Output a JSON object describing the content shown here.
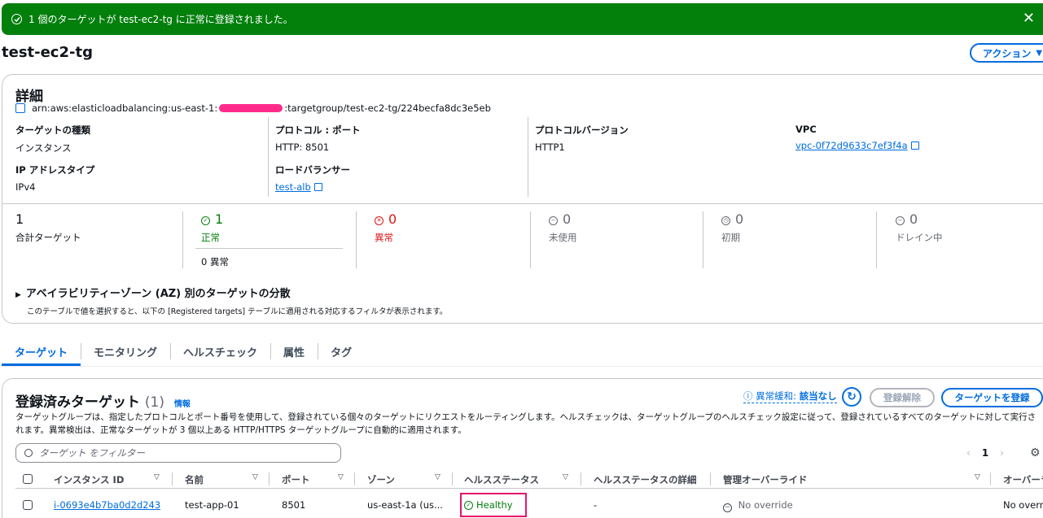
{
  "flash": {
    "message": "1 個のターゲットが test-ec2-tg に正常に登録されました。",
    "close": "✕"
  },
  "page": {
    "title": "test-ec2-tg",
    "action_label": "アクション"
  },
  "details": {
    "title": "詳細",
    "arn_prefix": "arn:aws:elasticloadbalancing:us-east-1:",
    "arn_suffix": ":targetgroup/test-ec2-tg/224becfa8dc3e5eb",
    "target_type": {
      "k": "ターゲットの種類",
      "v": "インスタンス"
    },
    "protocol_port": {
      "k": "プロトコル : ポート",
      "v": "HTTP: 8501"
    },
    "protocol_version": {
      "k": "プロトコルバージョン",
      "v": "HTTP1"
    },
    "vpc": {
      "k": "VPC",
      "v": "vpc-0f72d9633c7ef3f4a"
    },
    "ip_type": {
      "k": "IP アドレスタイプ",
      "v": "IPv4"
    },
    "load_balancer": {
      "k": "ロードバランサー",
      "v": "test-alb"
    }
  },
  "stats": {
    "total": {
      "num": "1",
      "lbl": "合計ターゲット"
    },
    "healthy": {
      "num": "1",
      "lbl": "正常",
      "sub": "0 異常"
    },
    "unhealthy": {
      "num": "0",
      "lbl": "異常"
    },
    "unused": {
      "num": "0",
      "lbl": "未使用"
    },
    "initial": {
      "num": "0",
      "lbl": "初期"
    },
    "draining": {
      "num": "0",
      "lbl": "ドレイン中"
    }
  },
  "az": {
    "title": "アベイラビリティーゾーン (AZ) 別のターゲットの分散",
    "desc": "このテーブルで値を選択すると、以下の [Registered targets] テーブルに適用される対応するフィルタが表示されます。"
  },
  "tabs": [
    "ターゲット",
    "モニタリング",
    "ヘルスチェック",
    "属性",
    "タグ"
  ],
  "targets": {
    "title": "登録済みターゲット",
    "count": "(1)",
    "info": "情報",
    "anomaly_prefix": "異常緩和:",
    "anomaly_value": "該当なし",
    "dereg_label": "登録解除",
    "register_label": "ターゲットを登録",
    "description": "ターゲットグループは、指定したプロトコルとポート番号を使用して、登録されている個々のターゲットにリクエストをルーティングします。ヘルスチェックは、ターゲットグループのヘルスチェック設定に従って、登録されているすべてのターゲットに対して実行されます。異常検出は、正常なターゲットが 3 個以上ある HTTP/HTTPS ターゲットグループに自動的に適用されます。",
    "filter_placeholder": "ターゲット をフィルター",
    "page": "1",
    "columns": [
      "インスタンス ID",
      "名前",
      "ポート",
      "ゾーン",
      "ヘルスステータス",
      "ヘルスステータスの詳細",
      "管理オーバーライド",
      "オーバーライ"
    ],
    "row": {
      "instance_id": "i-0693e4b7ba0d2d243",
      "name": "test-app-01",
      "port": "8501",
      "zone": "us-east-1a (us...",
      "health": "Healthy",
      "health_detail": "-",
      "override": "No override",
      "override2": "No overrid"
    }
  }
}
